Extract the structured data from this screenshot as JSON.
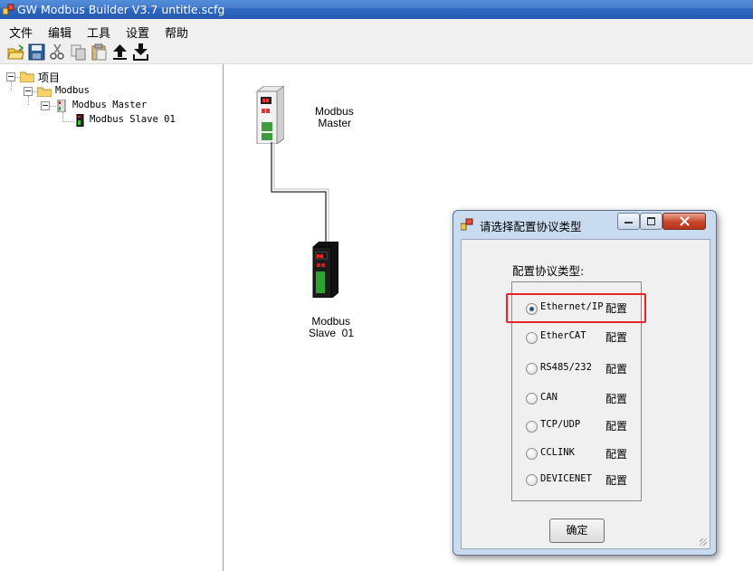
{
  "window": {
    "title": "GW Modbus Builder V3.7   untitle.scfg"
  },
  "menu": {
    "items": [
      "文件",
      "编辑",
      "工具",
      "设置",
      "帮助"
    ]
  },
  "toolbar": {
    "buttons": [
      "open-folder-icon",
      "save-icon",
      "cut-icon",
      "copy-icon",
      "paste-icon",
      "upload-icon",
      "download-icon"
    ]
  },
  "tree": {
    "root": "项目",
    "modbus": "Modbus",
    "master": "Modbus Master",
    "slave": "Modbus Slave  01"
  },
  "canvas": {
    "master_label": "Modbus\n Master",
    "slave_label": " Modbus\nSlave  01"
  },
  "dialog": {
    "title": "请选择配置协议类型",
    "group_label": "配置协议类型:",
    "selected": "Ethernet/IP",
    "options": [
      {
        "label": "Ethernet/IP",
        "action": "配置",
        "checked": true
      },
      {
        "label": "EtherCAT",
        "action": "配置",
        "checked": false
      },
      {
        "label": "RS485/232",
        "action": "配置",
        "checked": false
      },
      {
        "label": "CAN",
        "action": "配置",
        "checked": false
      },
      {
        "label": "TCP/UDP",
        "action": "配置",
        "checked": false
      },
      {
        "label": "CCLINK",
        "action": "配置",
        "checked": false
      },
      {
        "label": "DEVICENET",
        "action": "配置",
        "checked": false
      }
    ],
    "ok_label": "确定"
  },
  "colors": {
    "titlebar": "#2a64be",
    "dialog_frame": "#c9dbee",
    "highlight": "#e8262a",
    "radio_checked": "#24527e"
  }
}
